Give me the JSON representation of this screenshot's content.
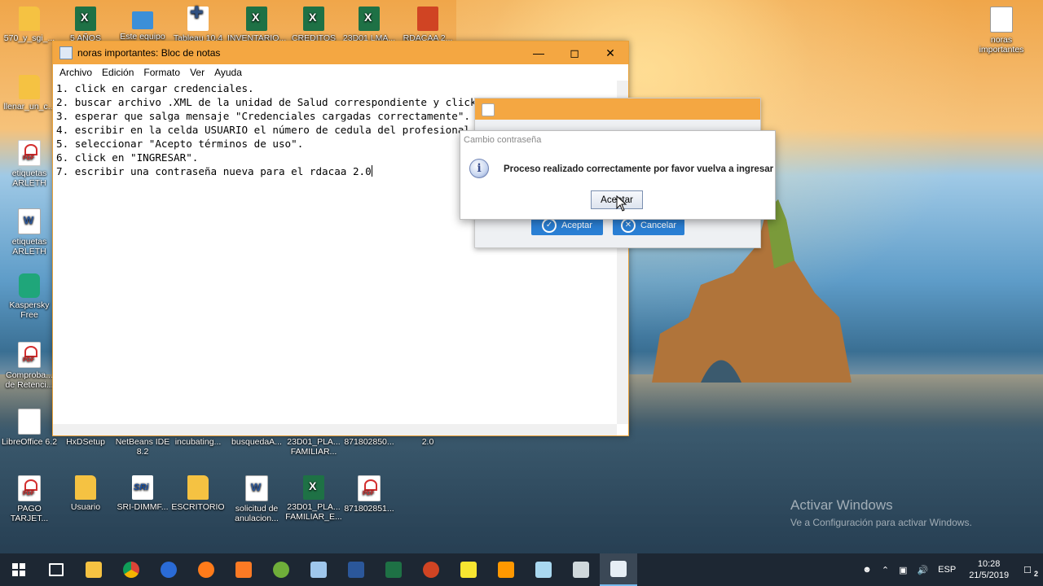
{
  "desktop": {
    "icons": [
      {
        "label": "570_y_sgi_...",
        "kind": "folder"
      },
      {
        "label": "5 AÑOS",
        "kind": "xls"
      },
      {
        "label": "Este equipo",
        "kind": "pc"
      },
      {
        "label": "Tableau 10.4",
        "kind": "tab"
      },
      {
        "label": "INVENTARIO...",
        "kind": "xls"
      },
      {
        "label": "CREDITOS",
        "kind": "xls"
      },
      {
        "label": "23D01 LMA...",
        "kind": "xls"
      },
      {
        "label": "RDACAA 2...",
        "kind": "ppt"
      },
      {
        "label": "noras importantes",
        "kind": "txt"
      },
      {
        "label": "llenar_un_c...",
        "kind": "folder"
      },
      {
        "label": "etiquetas ARLETH",
        "kind": "pdf"
      },
      {
        "label": "etiquetas ARLETH",
        "kind": "doc"
      },
      {
        "label": "Kaspersky Free",
        "kind": "kas"
      },
      {
        "label": "Comproba... de Retenci...",
        "kind": "pdf"
      },
      {
        "label": "LibreOffice 6.2",
        "kind": "blank"
      },
      {
        "label": "HxDSetup",
        "kind": "blank"
      },
      {
        "label": "NetBeans IDE 8.2",
        "kind": "blank"
      },
      {
        "label": "incubating...",
        "kind": "blank"
      },
      {
        "label": "busquedaA...",
        "kind": "blank"
      },
      {
        "label": "23D01_PLA... FAMILIAR...",
        "kind": "blank"
      },
      {
        "label": "871802850...",
        "kind": "blank"
      },
      {
        "label": "2.0",
        "kind": "blank"
      },
      {
        "label": "PAGO TARJET...",
        "kind": "pdf"
      },
      {
        "label": "Usuario",
        "kind": "folder"
      },
      {
        "label": "SRI-DIMMF...",
        "kind": "sri"
      },
      {
        "label": "ESCRITORIO",
        "kind": "folder"
      },
      {
        "label": "solicitud de anulacion...",
        "kind": "doc"
      },
      {
        "label": "23D01_PLA... FAMILIAR_E...",
        "kind": "xls"
      },
      {
        "label": "871802851...",
        "kind": "pdf"
      }
    ]
  },
  "notepad": {
    "title": "noras importantes: Bloc de notas",
    "menu": [
      "Archivo",
      "Edición",
      "Formato",
      "Ver",
      "Ayuda"
    ],
    "lines": [
      "1. click en cargar credenciales.",
      "2. buscar archivo .XML de la unidad de Salud correspondiente y click",
      "3. esperar que salga mensaje \"Credenciales cargadas correctamente\".",
      "4. escribir en la celda USUARIO el número de cedula del profesional",
      "5. seleccionar \"Acepto términos de uso\".",
      "6. click en \"INGRESAR\".",
      "7. escribir una contraseña nueva para el rdacaa 2.0"
    ]
  },
  "java_dialog": {
    "accept_label": "Aceptar",
    "cancel_label": "Cancelar"
  },
  "message_dialog": {
    "title": "Cambio contraseña",
    "text": "Proceso realizado correctamente por favor vuelva a ingresar",
    "ok_label": "Aceptar"
  },
  "watermark": {
    "line1": "Activar Windows",
    "line2": "Ve a Configuración para activar Windows."
  },
  "taskbar": {
    "lang": "ESP",
    "time": "10:28",
    "date": "21/5/2019",
    "notifications": "2"
  }
}
